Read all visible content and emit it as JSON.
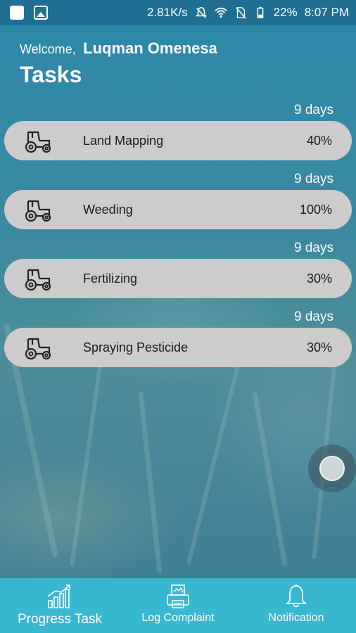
{
  "status_bar": {
    "speed": "2.81K/s",
    "battery": "22%",
    "time": "8:07 PM"
  },
  "header": {
    "welcome_label": "Welcome,",
    "user_name": "Luqman Omenesa",
    "title": "Tasks"
  },
  "tasks": [
    {
      "days": "9 days",
      "name": "Land Mapping",
      "percent": "40%",
      "icon": "tractor-icon"
    },
    {
      "days": "9 days",
      "name": "Weeding",
      "percent": "100%",
      "icon": "tractor-icon"
    },
    {
      "days": "9 days",
      "name": "Fertilizing",
      "percent": "30%",
      "icon": "tractor-icon"
    },
    {
      "days": "9 days",
      "name": "Spraying Pesticide",
      "percent": "30%",
      "icon": "tractor-icon"
    }
  ],
  "bottom_nav": {
    "items": [
      {
        "label": "Progress Task",
        "icon": "bar-chart-icon"
      },
      {
        "label": "Log Complaint",
        "icon": "complaint-printer-icon"
      },
      {
        "label": "Notification",
        "icon": "bell-icon"
      }
    ]
  },
  "colors": {
    "status_bar": "#1f6f93",
    "pill": "#cdcbcb",
    "bottom_nav": "#38b7d1"
  }
}
